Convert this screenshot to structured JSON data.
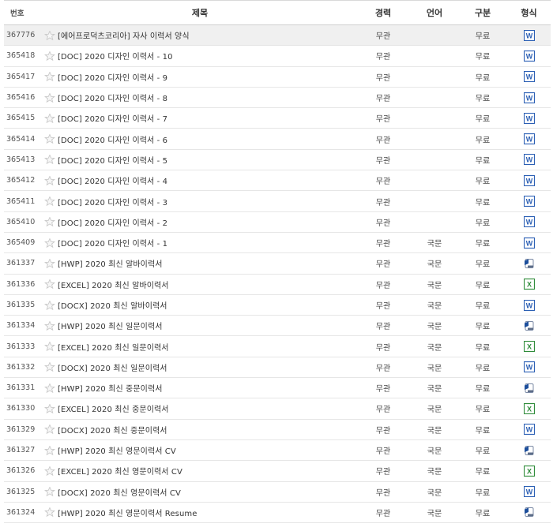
{
  "headers": {
    "num": "번호",
    "title": "제목",
    "experience": "경력",
    "language": "언어",
    "category": "구분",
    "format": "형식"
  },
  "icons": {
    "star": "star-outline-icon",
    "word": "word-doc-icon",
    "excel": "excel-icon",
    "hwp": "hwp-doc-icon"
  },
  "colors": {
    "word": "#2b5fb4",
    "excel": "#2e8b3a",
    "hwp": "#1d4f9c",
    "star": "#c9c9c9"
  },
  "rows": [
    {
      "num": "367776",
      "title": "[에어프로덕츠코리아] 자사 이력서 양식",
      "experience": "무관",
      "language": "",
      "category": "무료",
      "format": "word"
    },
    {
      "num": "365418",
      "title": "[DOC] 2020 디자인 이력서 - 10",
      "experience": "무관",
      "language": "",
      "category": "무료",
      "format": "word"
    },
    {
      "num": "365417",
      "title": "[DOC] 2020 디자인 이력서 - 9",
      "experience": "무관",
      "language": "",
      "category": "무료",
      "format": "word"
    },
    {
      "num": "365416",
      "title": "[DOC] 2020 디자인 이력서 - 8",
      "experience": "무관",
      "language": "",
      "category": "무료",
      "format": "word"
    },
    {
      "num": "365415",
      "title": "[DOC] 2020 디자인 이력서 - 7",
      "experience": "무관",
      "language": "",
      "category": "무료",
      "format": "word"
    },
    {
      "num": "365414",
      "title": "[DOC] 2020 디자인 이력서 - 6",
      "experience": "무관",
      "language": "",
      "category": "무료",
      "format": "word"
    },
    {
      "num": "365413",
      "title": "[DOC] 2020 디자인 이력서 - 5",
      "experience": "무관",
      "language": "",
      "category": "무료",
      "format": "word"
    },
    {
      "num": "365412",
      "title": "[DOC] 2020 디자인 이력서 - 4",
      "experience": "무관",
      "language": "",
      "category": "무료",
      "format": "word"
    },
    {
      "num": "365411",
      "title": "[DOC] 2020 디자인 이력서 - 3",
      "experience": "무관",
      "language": "",
      "category": "무료",
      "format": "word"
    },
    {
      "num": "365410",
      "title": "[DOC] 2020 디자인 이력서 - 2",
      "experience": "무관",
      "language": "",
      "category": "무료",
      "format": "word"
    },
    {
      "num": "365409",
      "title": "[DOC] 2020 디자인 이력서 - 1",
      "experience": "무관",
      "language": "국문",
      "category": "무료",
      "format": "word"
    },
    {
      "num": "361337",
      "title": "[HWP] 2020 최신 알바이력서",
      "experience": "무관",
      "language": "국문",
      "category": "무료",
      "format": "hwp"
    },
    {
      "num": "361336",
      "title": "[EXCEL] 2020 최신 알바이력서",
      "experience": "무관",
      "language": "국문",
      "category": "무료",
      "format": "excel"
    },
    {
      "num": "361335",
      "title": "[DOCX] 2020 최신 알바이력서",
      "experience": "무관",
      "language": "국문",
      "category": "무료",
      "format": "word"
    },
    {
      "num": "361334",
      "title": "[HWP] 2020 최신 일문이력서",
      "experience": "무관",
      "language": "국문",
      "category": "무료",
      "format": "hwp"
    },
    {
      "num": "361333",
      "title": "[EXCEL] 2020 최신 일문이력서",
      "experience": "무관",
      "language": "국문",
      "category": "무료",
      "format": "excel"
    },
    {
      "num": "361332",
      "title": "[DOCX] 2020 최신 일문이력서",
      "experience": "무관",
      "language": "국문",
      "category": "무료",
      "format": "word"
    },
    {
      "num": "361331",
      "title": "[HWP] 2020 최신 중문이력서",
      "experience": "무관",
      "language": "국문",
      "category": "무료",
      "format": "hwp"
    },
    {
      "num": "361330",
      "title": "[EXCEL] 2020 최신 중문이력서",
      "experience": "무관",
      "language": "국문",
      "category": "무료",
      "format": "excel"
    },
    {
      "num": "361329",
      "title": "[DOCX] 2020 최신 중문이력서",
      "experience": "무관",
      "language": "국문",
      "category": "무료",
      "format": "word"
    },
    {
      "num": "361327",
      "title": "[HWP] 2020 최신 영문이력서 CV",
      "experience": "무관",
      "language": "국문",
      "category": "무료",
      "format": "hwp"
    },
    {
      "num": "361326",
      "title": "[EXCEL] 2020 최신 영문이력서 CV",
      "experience": "무관",
      "language": "국문",
      "category": "무료",
      "format": "excel"
    },
    {
      "num": "361325",
      "title": "[DOCX] 2020 최신 영문이력서 CV",
      "experience": "무관",
      "language": "국문",
      "category": "무료",
      "format": "word"
    },
    {
      "num": "361324",
      "title": "[HWP] 2020 최신 영문이력서 Resume",
      "experience": "무관",
      "language": "국문",
      "category": "무료",
      "format": "hwp"
    }
  ]
}
